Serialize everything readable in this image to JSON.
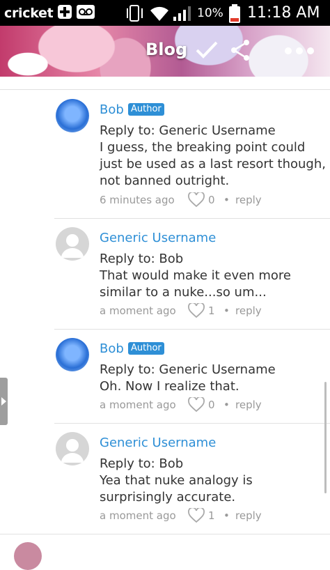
{
  "statusbar": {
    "carrier": "cricket",
    "battery": "10%",
    "time": "11:18 AM"
  },
  "header": {
    "title": "Blog"
  },
  "comments": [
    {
      "author": "Bob",
      "badge": "Author",
      "lines": [
        "Reply to: Generic Username",
        "I guess, the breaking point could",
        "just be used as a last resort though,",
        "not banned outright."
      ],
      "time": "6 minutes ago",
      "likes": "0",
      "reply": "reply"
    },
    {
      "author": "Generic Username",
      "badge": "",
      "lines": [
        "Reply to: Bob",
        "That would make it even more",
        "similar to a nuke...so um..."
      ],
      "time": "a moment ago",
      "likes": "1",
      "reply": "reply"
    },
    {
      "author": "Bob",
      "badge": "Author",
      "lines": [
        "Reply to: Generic Username",
        "Oh. Now I realize that."
      ],
      "time": "a moment ago",
      "likes": "0",
      "reply": "reply"
    },
    {
      "author": "Generic Username",
      "badge": "",
      "lines": [
        "Reply to: Bob",
        "Yea that nuke analogy is",
        "surprisingly accurate."
      ],
      "time": "a moment ago",
      "likes": "1",
      "reply": "reply"
    }
  ],
  "colors": {
    "link": "#2e8fd6",
    "meta": "#999999",
    "text": "#333333"
  },
  "icons": [
    "plus-icon",
    "voicemail-icon",
    "vibrate-icon",
    "wifi-icon",
    "signal-icon",
    "battery-icon",
    "heart-icon",
    "share-icon",
    "more-icon",
    "check-icon"
  ]
}
